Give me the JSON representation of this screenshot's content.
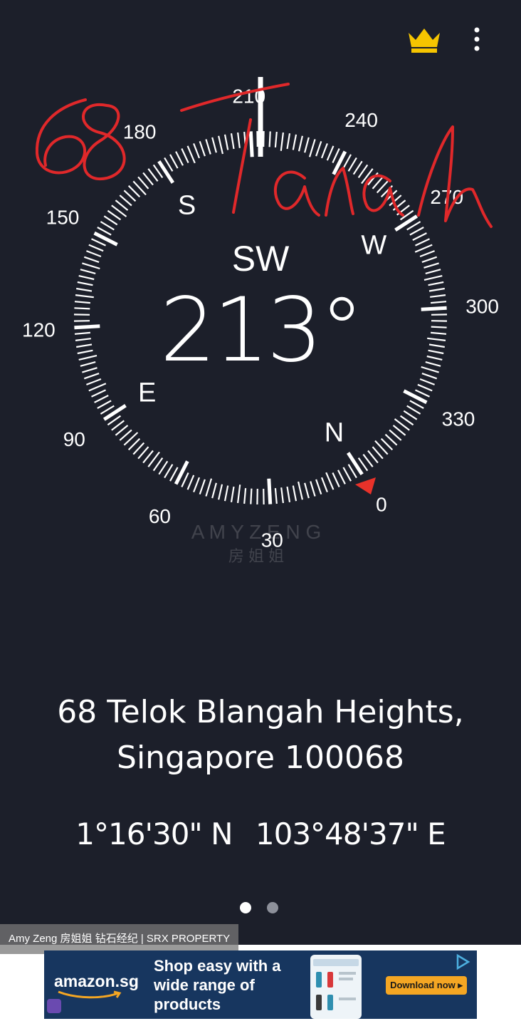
{
  "compass": {
    "direction": "SW",
    "heading": "213°",
    "cardinals": [
      "N",
      "E",
      "S",
      "W"
    ],
    "degree_labels": [
      "0",
      "30",
      "60",
      "90",
      "120",
      "150",
      "180",
      "210",
      "240",
      "270",
      "300",
      "330"
    ],
    "colors": {
      "background": "#1c1f2a",
      "ticks": "#ffffff",
      "north_marker": "#e8322a"
    }
  },
  "annotation": {
    "number": "68",
    "word": "Tanah",
    "color": "#e0282a"
  },
  "watermark": {
    "latin": "A M Y   Z E N G",
    "chinese": "房 姐 姐"
  },
  "location": {
    "address_line1": "68 Telok Blangah Heights,",
    "address_line2": "Singapore 100068",
    "latitude": "1°16'30\" N",
    "longitude": "103°48'37\" E"
  },
  "pager": {
    "pages": 2,
    "active": 1
  },
  "toolbar": {
    "premium_icon": "crown-icon",
    "menu_icon": "more-vert-icon",
    "crown_color": "#f6c500"
  },
  "caption": "Amy Zeng 房姐姐 钻石经纪 | SRX PROPERTY",
  "ad": {
    "brand": "amazon.sg",
    "tagline": "Shop easy with a wide range of products",
    "cta": "Download now ▸",
    "colors": {
      "background": "#17365f",
      "cta": "#f4a623"
    }
  }
}
